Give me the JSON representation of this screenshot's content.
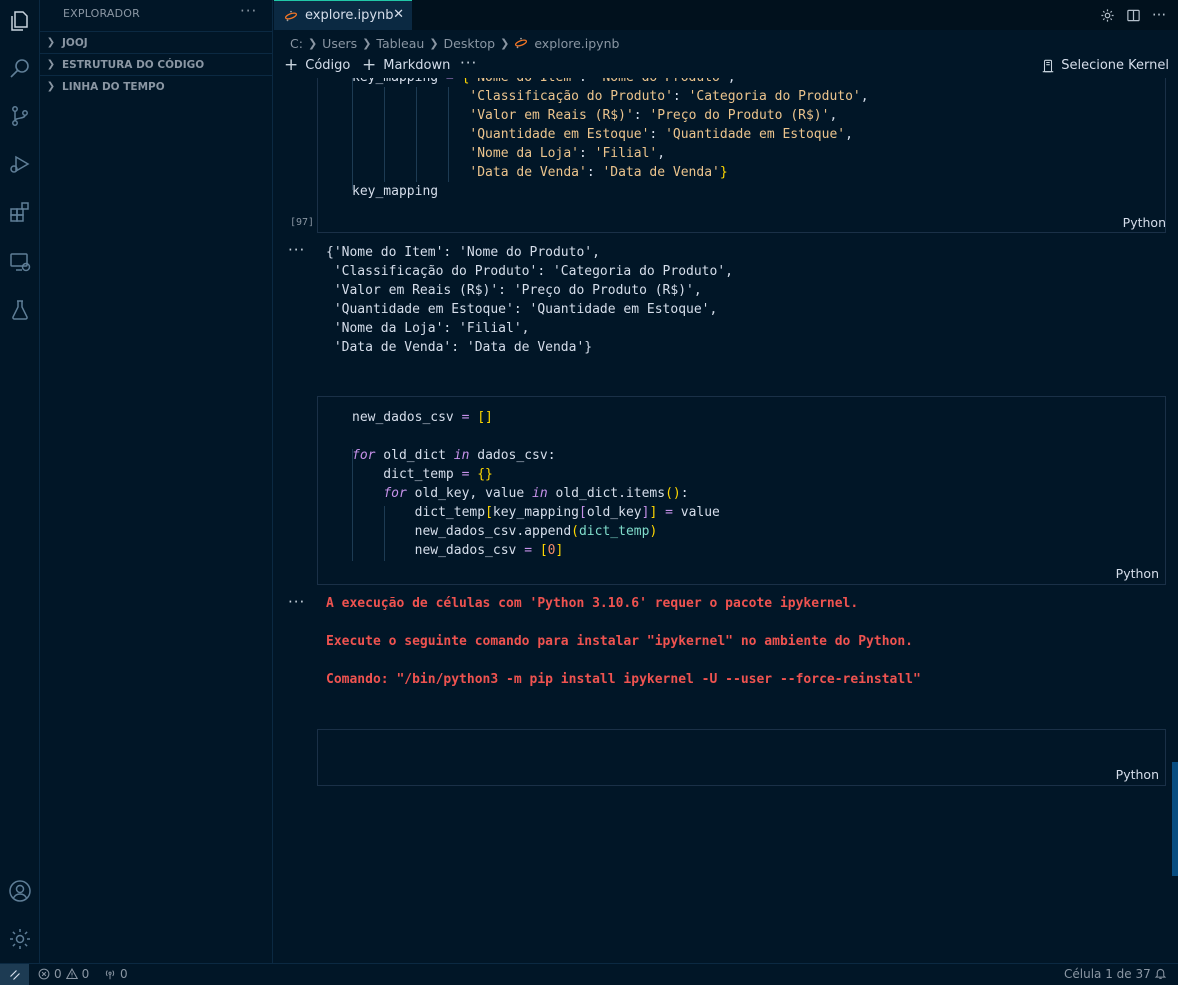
{
  "activity_bar": {
    "icons": [
      "explorer-icon",
      "search-icon",
      "source-control-icon",
      "run-debug-icon",
      "extensions-icon",
      "remote-explorer-icon",
      "testing-icon",
      "account-icon",
      "manage-gear-icon"
    ]
  },
  "sidebar": {
    "title": "EXPLORADOR",
    "more": "···",
    "sections": [
      {
        "label": "JOOJ"
      },
      {
        "label": "ESTRUTURA DO CÓDIGO"
      },
      {
        "label": "LINHA DO TEMPO"
      }
    ]
  },
  "tabs": [
    {
      "label": "explore.ipynb",
      "active": true,
      "close": "✕"
    }
  ],
  "breadcrumb": {
    "items": [
      "C:",
      "Users",
      "Tableau",
      "Desktop"
    ],
    "file": "explore.ipynb"
  },
  "notebook_toolbar": {
    "add_code": "Código",
    "add_markdown": "Markdown",
    "more": "···",
    "kernel": "Selecione Kernel"
  },
  "cells": {
    "cell1": {
      "exec_count": "[97]",
      "language": "Python",
      "lines": [
        "key_mapping = {'Nome do Item': 'Nome do Produto',",
        "               'Classificação do Produto': 'Categoria do Produto',",
        "               'Valor em Reais (R$)': 'Preço do Produto (R$)',",
        "               'Quantidade em Estoque': 'Quantidade em Estoque',",
        "               'Nome da Loja': 'Filial',",
        "               'Data de Venda': 'Data de Venda'}",
        "key_mapping"
      ],
      "output_more": "···",
      "output_lines": [
        "{'Nome do Item': 'Nome do Produto',",
        " 'Classificação do Produto': 'Categoria do Produto',",
        " 'Valor em Reais (R$)': 'Preço do Produto (R$)',",
        " 'Quantidade em Estoque': 'Quantidade em Estoque',",
        " 'Nome da Loja': 'Filial',",
        " 'Data de Venda': 'Data de Venda'}"
      ]
    },
    "cell2": {
      "language": "Python",
      "lines": [
        "new_dados_csv = []",
        "",
        "for old_dict in dados_csv:",
        "    dict_temp = {}",
        "    for old_key, value in old_dict.items():",
        "        dict_temp[key_mapping[old_key]] = value",
        "        new_dados_csv.append(dict_temp)",
        "        new_dados_csv = [0]"
      ],
      "output_more": "···",
      "error_lines": [
        "A execução de células com 'Python 3.10.6' requer o pacote ipykernel.",
        "Execute o seguinte comando para instalar \"ipykernel\" no ambiente do Python.",
        "Comando: \"/bin/python3 -m pip install ipykernel -U --user --force-reinstall\""
      ]
    },
    "cell3": {
      "language": "Python"
    }
  },
  "status_bar": {
    "errors": "0",
    "warnings": "0",
    "ports": "0",
    "cell_position": "Célula 1 de 37"
  },
  "colors": {
    "background": "#011627",
    "accent": "#21c7a8",
    "error": "#ef5350",
    "string": "#ecc48d",
    "keyword": "#c792ea"
  }
}
